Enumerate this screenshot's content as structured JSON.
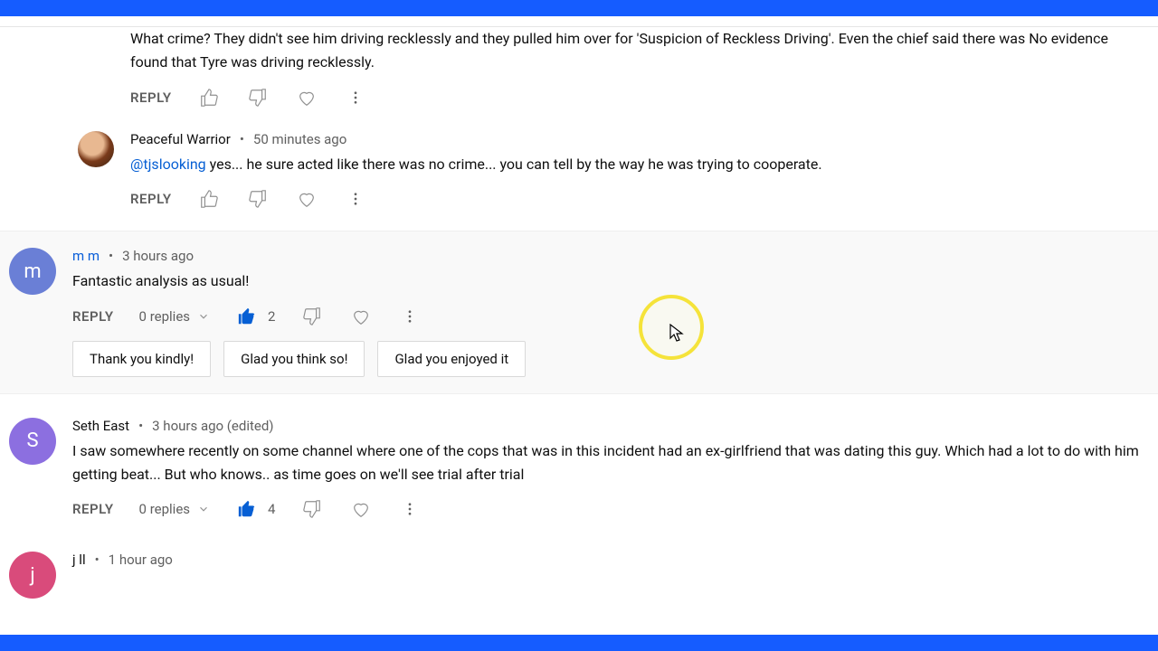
{
  "replies": [
    {
      "author": "",
      "timestamp": "",
      "text": "What crime? They didn't see him driving recklessly and they pulled him over for 'Suspicion of Reckless Driving'. Even the chief said there was No evidence found that Tyre was driving recklessly.",
      "reply_label": "REPLY"
    },
    {
      "author": "Peaceful Warrior",
      "timestamp": "50 minutes ago",
      "mention": "@tjslooking",
      "text": "  yes... he sure acted like there was no crime... you can tell by the way he was trying to cooperate.",
      "reply_label": "REPLY"
    }
  ],
  "comments": [
    {
      "author": "m m",
      "timestamp": "3 hours ago",
      "text": "Fantastic analysis as usual!",
      "reply_label": "REPLY",
      "replies_label": "0 replies",
      "like_count": "2",
      "avatar_letter": "m",
      "avatar_bg": "#6a7fd6",
      "suggestions": [
        "Thank you kindly!",
        "Glad you think so!",
        "Glad you enjoyed it"
      ]
    },
    {
      "author": "Seth East",
      "timestamp": "3 hours ago (edited)",
      "text": "I saw somewhere recently on some channel where one of the cops that was in this incident had an ex-girlfriend that was dating this guy. Which had a lot to do with him getting beat... But who knows.. as time goes on we'll see trial after trial",
      "reply_label": "REPLY",
      "replies_label": "0 replies",
      "like_count": "4",
      "avatar_letter": "S",
      "avatar_bg": "#8c6fe0"
    },
    {
      "author": "j ll",
      "timestamp": "1 hour ago",
      "avatar_letter": "j",
      "avatar_bg": "#d94b7b"
    }
  ]
}
